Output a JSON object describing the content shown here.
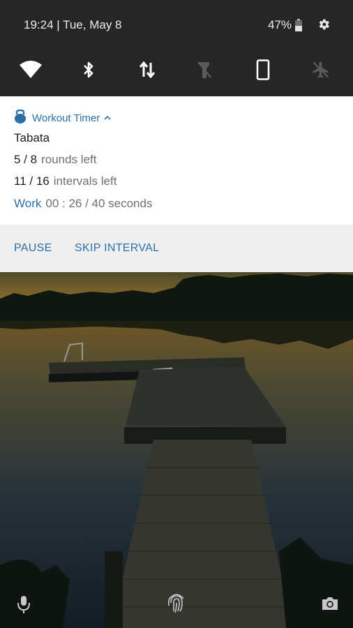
{
  "status": {
    "time_date": "19:24 | Tue, May 8",
    "battery": "47%",
    "battery_level": 0.47
  },
  "quick_settings": [
    "wifi-icon",
    "bluetooth-icon",
    "data-arrows-icon",
    "flashlight-icon",
    "phone-rotate-icon",
    "airplane-icon"
  ],
  "notification": {
    "app_name": "Workout Timer",
    "title": "Tabata",
    "rounds_value": "5 / 8",
    "rounds_label": "rounds left",
    "intervals_value": "11 / 16",
    "intervals_label": "intervals left",
    "phase": "Work",
    "timer": "00 : 26 / 40 seconds",
    "actions": {
      "pause": "PAUSE",
      "skip": "SKIP INTERVAL"
    }
  },
  "colors": {
    "accent": "#2b6fa8",
    "statusbar_bg": "#262626",
    "action_bar_bg": "#efefef"
  },
  "lockscreen": {
    "icons": [
      "microphone-icon",
      "fingerprint-icon",
      "camera-icon"
    ]
  }
}
